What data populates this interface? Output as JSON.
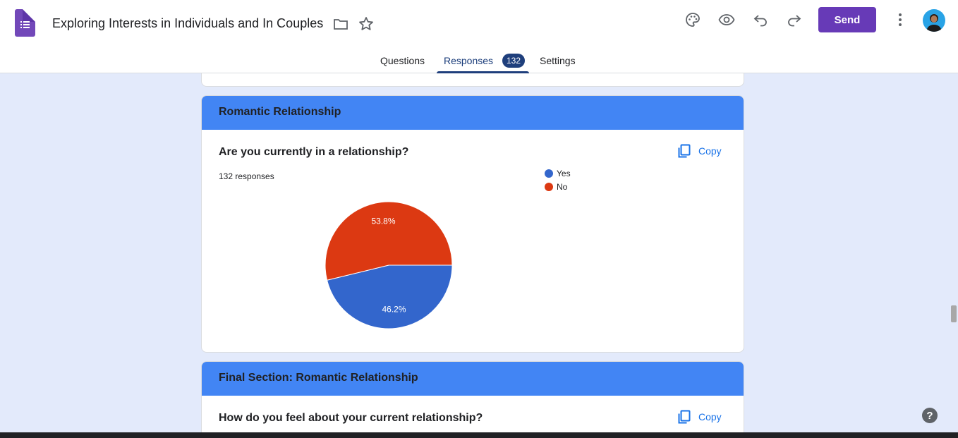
{
  "header": {
    "title": "Exploring Interests in Individuals and In Couples",
    "send_label": "Send"
  },
  "tabs": [
    {
      "label": "Questions"
    },
    {
      "label": "Responses",
      "badge": "132"
    },
    {
      "label": "Settings"
    }
  ],
  "sections": [
    {
      "title": "Romantic Relationship",
      "question": "Are you currently in a relationship?",
      "responses": "132 responses",
      "copy_label": "Copy"
    },
    {
      "title": "Final Section: Romantic Relationship",
      "question": "How do you feel about your current relationship?",
      "copy_label": "Copy"
    }
  ],
  "chart_data": {
    "type": "pie",
    "slices": [
      {
        "label": "Yes",
        "value": 46.2,
        "display": "46.2%",
        "color": "#3366cc"
      },
      {
        "label": "No",
        "value": 53.8,
        "display": "53.8%",
        "color": "#dc3912"
      }
    ]
  },
  "colors": {
    "accent": "#673ab7",
    "section_header": "#4285f4",
    "tab_active": "#1f3f7c",
    "copy": "#1a73e8"
  },
  "icons": [
    "forms-logo-icon",
    "folder-icon",
    "star-icon",
    "palette-icon",
    "eye-icon",
    "undo-icon",
    "redo-icon",
    "more-vert-icon",
    "copy-icon",
    "help-icon"
  ]
}
